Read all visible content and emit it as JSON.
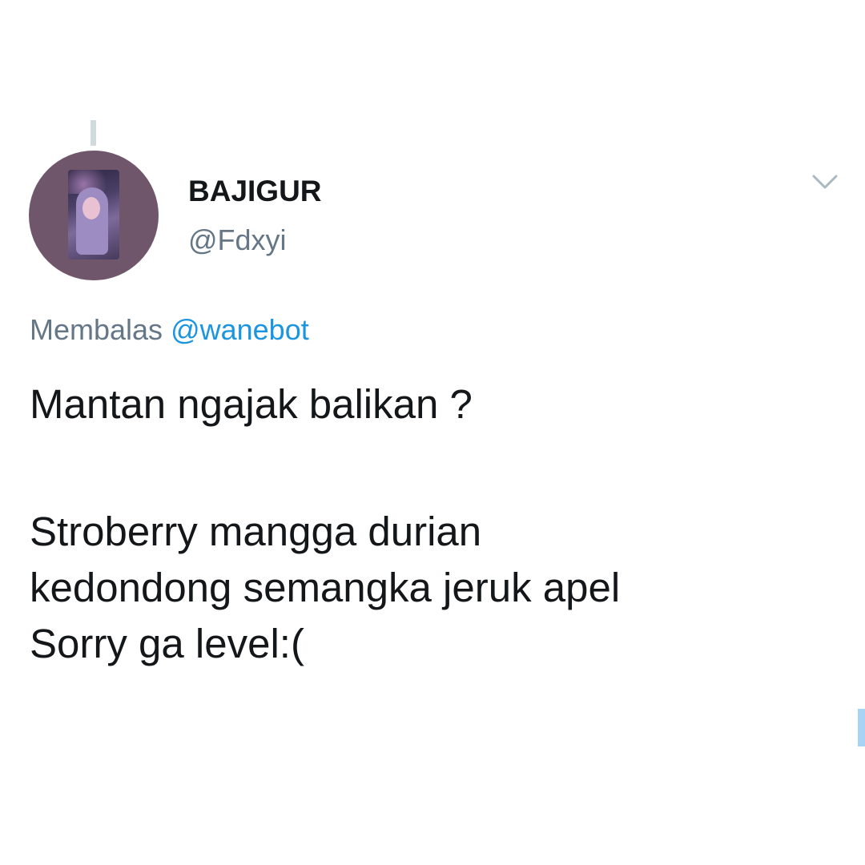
{
  "tweet": {
    "author": {
      "display_name": "BAJIGUR",
      "handle": "@Fdxyi"
    },
    "reply_to": {
      "prefix": "Membalas",
      "mention": "@wanebot"
    },
    "body_lines": [
      "Mantan ngajak balikan ?",
      "Stroberry mangga durian",
      "kedondong semangka jeruk apel",
      "Sorry ga level:("
    ],
    "menu_icon": "chevron-down-icon"
  },
  "colors": {
    "text_primary": "#14171a",
    "text_secondary": "#657786",
    "link": "#1b95e0",
    "background": "#ffffff"
  }
}
